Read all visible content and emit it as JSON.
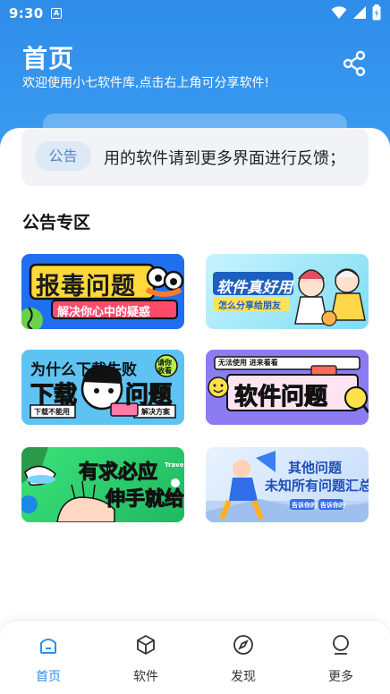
{
  "status": {
    "time": "9:30",
    "a_icon": "A"
  },
  "header": {
    "title": "首页",
    "subtitle": "欢迎使用小七软件库,点击右上角可分享软件!",
    "share_icon": "share-icon"
  },
  "notice": {
    "badge": "公告",
    "text": "用的软件请到更多界面进行反馈；"
  },
  "section_title": "公告专区",
  "banners": [
    {
      "title": "报毒问题",
      "subtitle": "解决你心中的疑惑"
    },
    {
      "title": "软件真好用",
      "subtitle": "怎么分享给朋友"
    },
    {
      "title": "为什么下载失败",
      "big1": "下载",
      "big2": "问题",
      "tag1": "下载不能用",
      "tag2": "解决方案",
      "badge": "请你收看"
    },
    {
      "title": "软件问题",
      "top": "无法使用 进来看看"
    },
    {
      "title1": "有求必应",
      "title2": "伸手就给",
      "small": "Travel"
    },
    {
      "title1": "其他问题",
      "title2": "未知所有问题汇总",
      "tag1": "告诉你的",
      "tag2": "告诉你的"
    }
  ],
  "nav": [
    {
      "label": "首页",
      "icon": "home-icon",
      "active": true
    },
    {
      "label": "软件",
      "icon": "cube-icon",
      "active": false
    },
    {
      "label": "发现",
      "icon": "compass-icon",
      "active": false
    },
    {
      "label": "更多",
      "icon": "more-icon",
      "active": false
    }
  ],
  "colors": {
    "primary": "#2f8dea",
    "badge_bg": "#dde9f7",
    "notice_bg": "#f1f3f6"
  }
}
